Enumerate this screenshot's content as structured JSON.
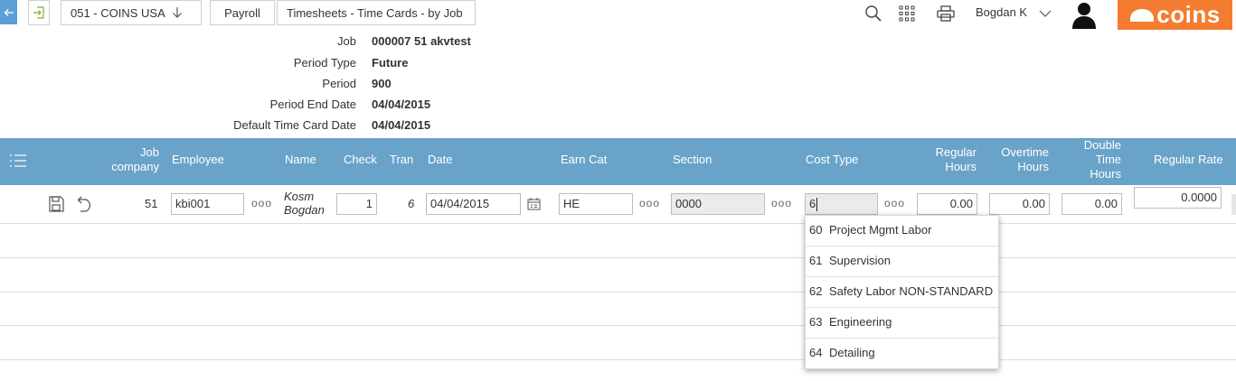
{
  "breadcrumb": {
    "company": "051 - COINS USA",
    "module": "Payroll",
    "page": "Timesheets - Time Cards - by Job"
  },
  "header": {
    "user_name": "Bogdan K",
    "brand": "coins"
  },
  "info": {
    "job_label": "Job",
    "job_value": "000007 51 akvtest",
    "period_type_label": "Period Type",
    "period_type_value": "Future",
    "period_label": "Period",
    "period_value": "900",
    "period_end_label": "Period End Date",
    "period_end_value": "04/04/2015",
    "default_date_label": "Default Time Card Date",
    "default_date_value": "04/04/2015"
  },
  "columns": {
    "job_company_1": "Job",
    "job_company_2": "company",
    "employee": "Employee",
    "name": "Name",
    "check": "Check",
    "tran": "Tran",
    "date": "Date",
    "earn_cat": "Earn Cat",
    "section": "Section",
    "cost_type": "Cost Type",
    "regular_hours_1": "Regular",
    "regular_hours_2": "Hours",
    "overtime_hours_1": "Overtime",
    "overtime_hours_2": "Hours",
    "double_time_1": "Double",
    "double_time_2": "Time",
    "double_time_3": "Hours",
    "regular_rate": "Regular Rate"
  },
  "row": {
    "job_company": "51",
    "employee": "kbi001",
    "name_1": "Kosm",
    "name_2": "Bogdan",
    "check": "1",
    "tran": "6",
    "date": "04/04/2015",
    "earn_cat": "HE",
    "section": "0000",
    "cost_type": "6",
    "regular_hours": "0.00",
    "overtime_hours": "0.00",
    "double_time_hours": "0.00",
    "regular_rate": "0.0000"
  },
  "dropdown": [
    {
      "code": "60",
      "label": "Project Mgmt Labor"
    },
    {
      "code": "61",
      "label": "Supervision"
    },
    {
      "code": "62",
      "label": "Safety Labor NON-STANDARD"
    },
    {
      "code": "63",
      "label": "Engineering"
    },
    {
      "code": "64",
      "label": "Detailing"
    }
  ],
  "colors": {
    "grid_header": "#6aa3c9",
    "brand": "#f47c30",
    "back_button": "#5b9fd6"
  },
  "dots_label": "ooo"
}
